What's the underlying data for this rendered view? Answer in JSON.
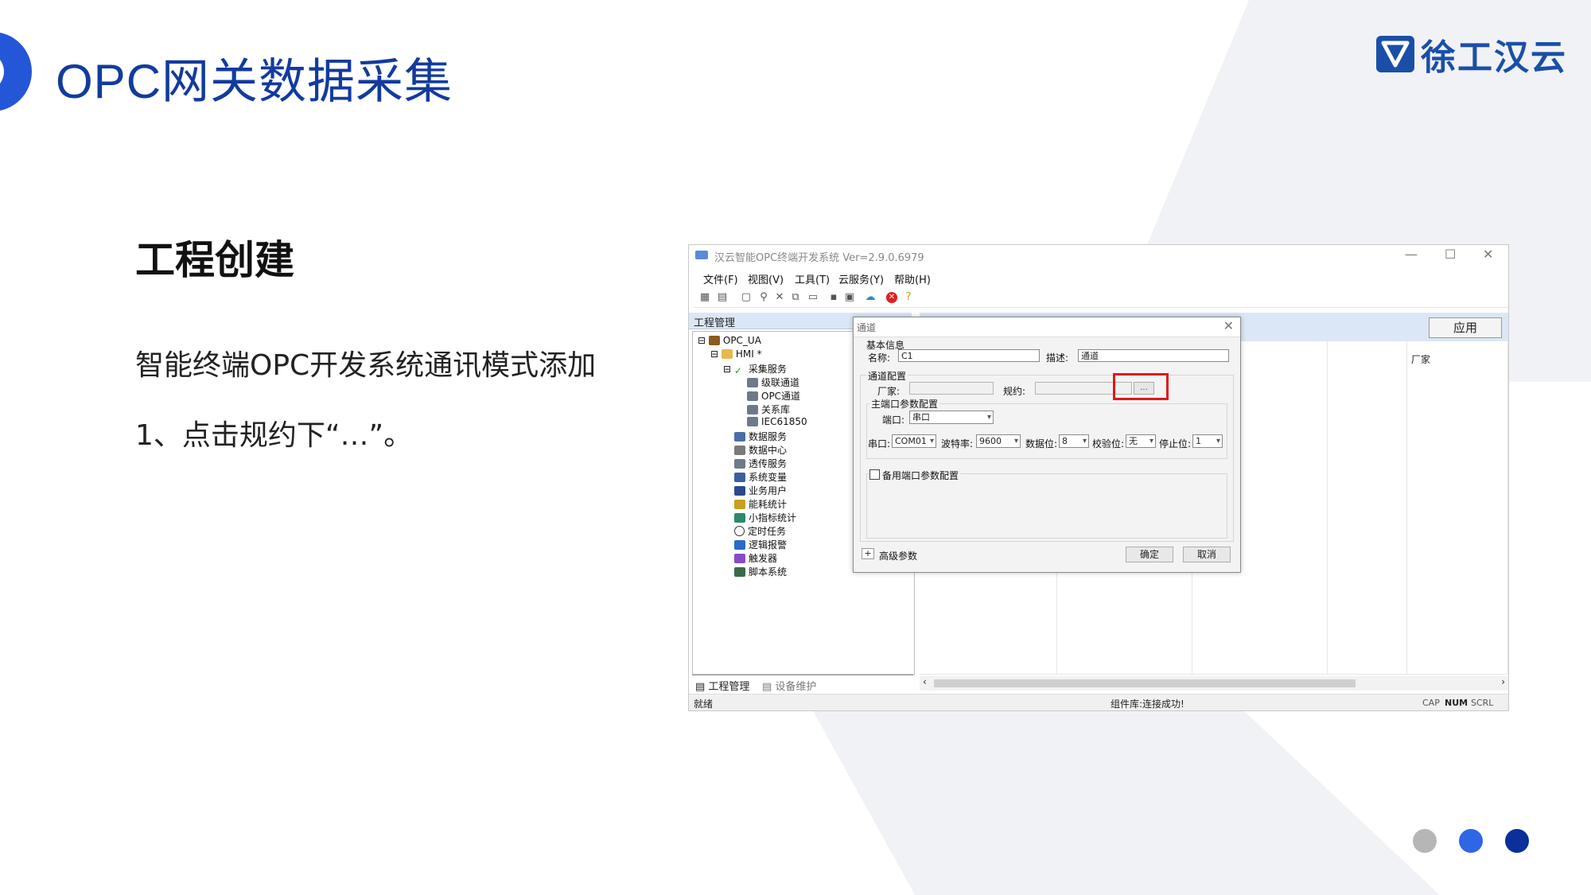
{
  "slide": {
    "title": "OPC网关数据采集",
    "logo_text": "徐工汉云",
    "section_title": "工程创建",
    "paragraph1": "智能终端OPC开发系统通讯模式添加",
    "paragraph2": "1、点击规约下“…”。"
  },
  "window": {
    "title": "汉云智能OPC终端开发系统 Ver=2.9.0.6979",
    "controls": {
      "minimize": "—",
      "maximize": "☐",
      "close": "✕"
    },
    "menu": [
      "文件(F)",
      "视图(V)",
      "工具(T)",
      "云服务(Y)",
      "帮助(H)"
    ],
    "left_panel_title": "工程管理",
    "tree": {
      "root": "OPC_UA",
      "hmi": "HMI *",
      "collect": "采集服务",
      "collect_children": [
        "级联通道",
        "OPC通道",
        "关系库",
        "IEC61850"
      ],
      "services": [
        "数据服务",
        "数据中心",
        "透传服务",
        "系统变量",
        "业务用户",
        "能耗统计",
        "小指标统计",
        "定时任务",
        "逻辑报警",
        "触发器",
        "脚本系统"
      ]
    },
    "bottom_tabs": [
      "工程管理",
      "设备维护"
    ],
    "apply_label": "应用",
    "column_label": "厂家",
    "status": {
      "left": "就绪",
      "center": "组件库:连接成功!",
      "cap": "CAP",
      "num": "NUM",
      "scrl": "SCRL"
    }
  },
  "dialog": {
    "title": "通道",
    "close": "✕",
    "basic_info": "基本信息",
    "name_label": "名称:",
    "name_value": "C1",
    "desc_label": "描述:",
    "desc_value": "通道",
    "channel_config": "通道配置",
    "vendor_label": "厂家:",
    "protocol_label": "规约:",
    "dots_label": "...",
    "main_port_config": "主端口参数配置",
    "port_label": "端口:",
    "port_value": "串口",
    "serial_label": "串口:",
    "serial_value": "COM01",
    "baud_label": "波特率:",
    "baud_value": "9600",
    "databits_label": "数据位:",
    "databits_value": "8",
    "parity_label": "校验位:",
    "parity_value": "无",
    "stopbits_label": "停止位:",
    "stopbits_value": "1",
    "backup_port_config": "备用端口参数配置",
    "advanced_label": "高级参数",
    "ok_label": "确定",
    "cancel_label": "取消"
  },
  "colors": {
    "title_blue": "#123b9e",
    "accent": "#2457d8",
    "highlight_red": "#e01818"
  }
}
